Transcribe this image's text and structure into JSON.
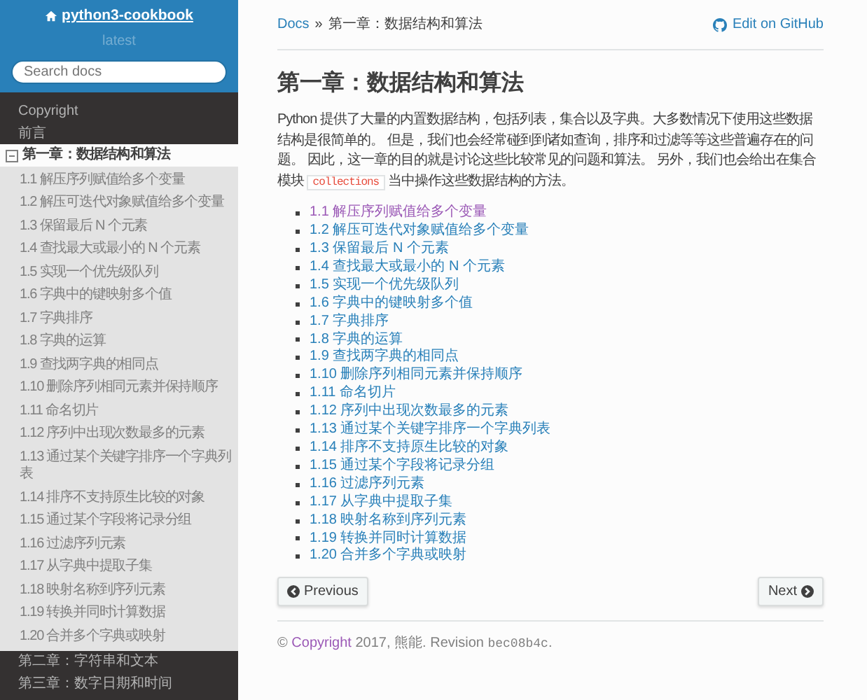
{
  "sidebar": {
    "project": "python3-cookbook",
    "version": "latest",
    "search": {
      "placeholder": "Search docs"
    },
    "items": [
      {
        "label": "Copyright",
        "current": false
      },
      {
        "label": "前言",
        "current": false
      },
      {
        "label": "第一章：数据结构和算法",
        "current": true,
        "expanded": true,
        "children": [
          {
            "label": "1.1 解压序列赋值给多个变量"
          },
          {
            "label": "1.2 解压可迭代对象赋值给多个变量"
          },
          {
            "label": "1.3 保留最后 N 个元素"
          },
          {
            "label": "1.4 查找最大或最小的 N 个元素"
          },
          {
            "label": "1.5 实现一个优先级队列"
          },
          {
            "label": "1.6 字典中的键映射多个值"
          },
          {
            "label": "1.7 字典排序"
          },
          {
            "label": "1.8 字典的运算"
          },
          {
            "label": "1.9 查找两字典的相同点"
          },
          {
            "label": "1.10 删除序列相同元素并保持顺序"
          },
          {
            "label": "1.11 命名切片"
          },
          {
            "label": "1.12 序列中出现次数最多的元素"
          },
          {
            "label": "1.13 通过某个关键字排序一个字典列表"
          },
          {
            "label": "1.14 排序不支持原生比较的对象"
          },
          {
            "label": "1.15 通过某个字段将记录分组"
          },
          {
            "label": "1.16 过滤序列元素"
          },
          {
            "label": "1.17 从字典中提取子集"
          },
          {
            "label": "1.18 映射名称到序列元素"
          },
          {
            "label": "1.19 转换并同时计算数据"
          },
          {
            "label": "1.20 合并多个字典或映射"
          }
        ]
      },
      {
        "label": "第二章：字符串和文本",
        "current": false
      },
      {
        "label": "第三章：数字日期和时间",
        "current": false
      }
    ]
  },
  "breadcrumb": {
    "root": "Docs",
    "separator": "»",
    "current": "第一章：数据结构和算法"
  },
  "edit_link": "Edit on GitHub",
  "heading": "第一章：数据结构和算法",
  "intro": {
    "before": "Python 提供了大量的内置数据结构，包括列表，集合以及字典。大多数情况下使用这些数据结构是很简单的。 但是，我们也会经常碰到到诸如查询，排序和过滤等等这些普遍存在的问题。 因此，这一章的目的就是讨论这些比较常见的问题和算法。 另外，我们也会给出在集合模块 ",
    "code": "collections",
    "after": " 当中操作这些数据结构的方法。"
  },
  "toc": [
    {
      "label": "1.1 解压序列赋值给多个变量",
      "visited": true
    },
    {
      "label": "1.2 解压可迭代对象赋值给多个变量",
      "visited": false
    },
    {
      "label": "1.3 保留最后 N 个元素",
      "visited": false
    },
    {
      "label": "1.4 查找最大或最小的 N 个元素",
      "visited": false
    },
    {
      "label": "1.5 实现一个优先级队列",
      "visited": false
    },
    {
      "label": "1.6 字典中的键映射多个值",
      "visited": false
    },
    {
      "label": "1.7 字典排序",
      "visited": false
    },
    {
      "label": "1.8 字典的运算",
      "visited": false
    },
    {
      "label": "1.9 查找两字典的相同点",
      "visited": false
    },
    {
      "label": "1.10 删除序列相同元素并保持顺序",
      "visited": false
    },
    {
      "label": "1.11 命名切片",
      "visited": false
    },
    {
      "label": "1.12 序列中出现次数最多的元素",
      "visited": false
    },
    {
      "label": "1.13 通过某个关键字排序一个字典列表",
      "visited": false
    },
    {
      "label": "1.14 排序不支持原生比较的对象",
      "visited": false
    },
    {
      "label": "1.15 通过某个字段将记录分组",
      "visited": false
    },
    {
      "label": "1.16 过滤序列元素",
      "visited": false
    },
    {
      "label": "1.17 从字典中提取子集",
      "visited": false
    },
    {
      "label": "1.18 映射名称到序列元素",
      "visited": false
    },
    {
      "label": "1.19 转换并同时计算数据",
      "visited": false
    },
    {
      "label": "1.20 合并多个字典或映射",
      "visited": false
    }
  ],
  "buttons": {
    "previous": "Previous",
    "next": "Next"
  },
  "footer": {
    "symbol": "©",
    "link": "Copyright",
    "text": " 2017, 熊能. Revision ",
    "revision": "bec08b4c",
    "end": "."
  }
}
